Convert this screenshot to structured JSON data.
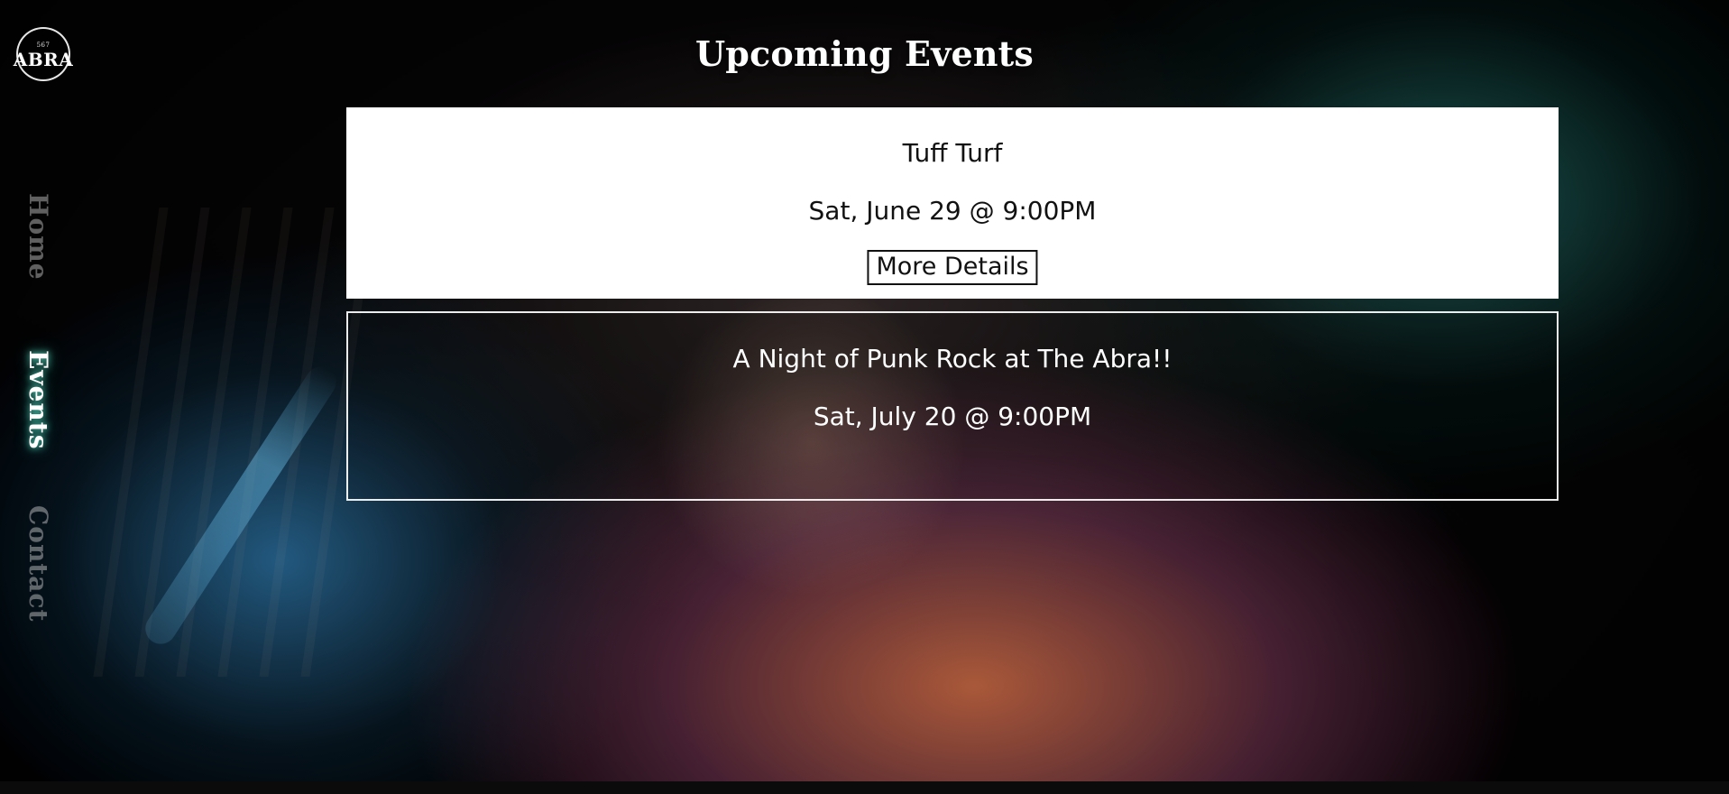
{
  "logo": {
    "small_text": "567",
    "main_text": "ABRA"
  },
  "sidebar": {
    "items": [
      {
        "label": "Home",
        "active": false
      },
      {
        "label": "Events",
        "active": true
      },
      {
        "label": "Contact",
        "active": false
      }
    ]
  },
  "page": {
    "title": "Upcoming Events"
  },
  "events": [
    {
      "title": "Tuff Turf",
      "date": "Sat, June 29 @ 9:00PM",
      "button_label": "More Details"
    },
    {
      "title": "A Night of Punk Rock at The Abra!!",
      "date": "Sat, July 20 @ 9:00PM"
    }
  ],
  "colors": {
    "nav_active_glow": "#5AF0D2",
    "card_bg": "#FFFFFF",
    "card_text": "#111111",
    "outline": "#FFFFFF"
  }
}
